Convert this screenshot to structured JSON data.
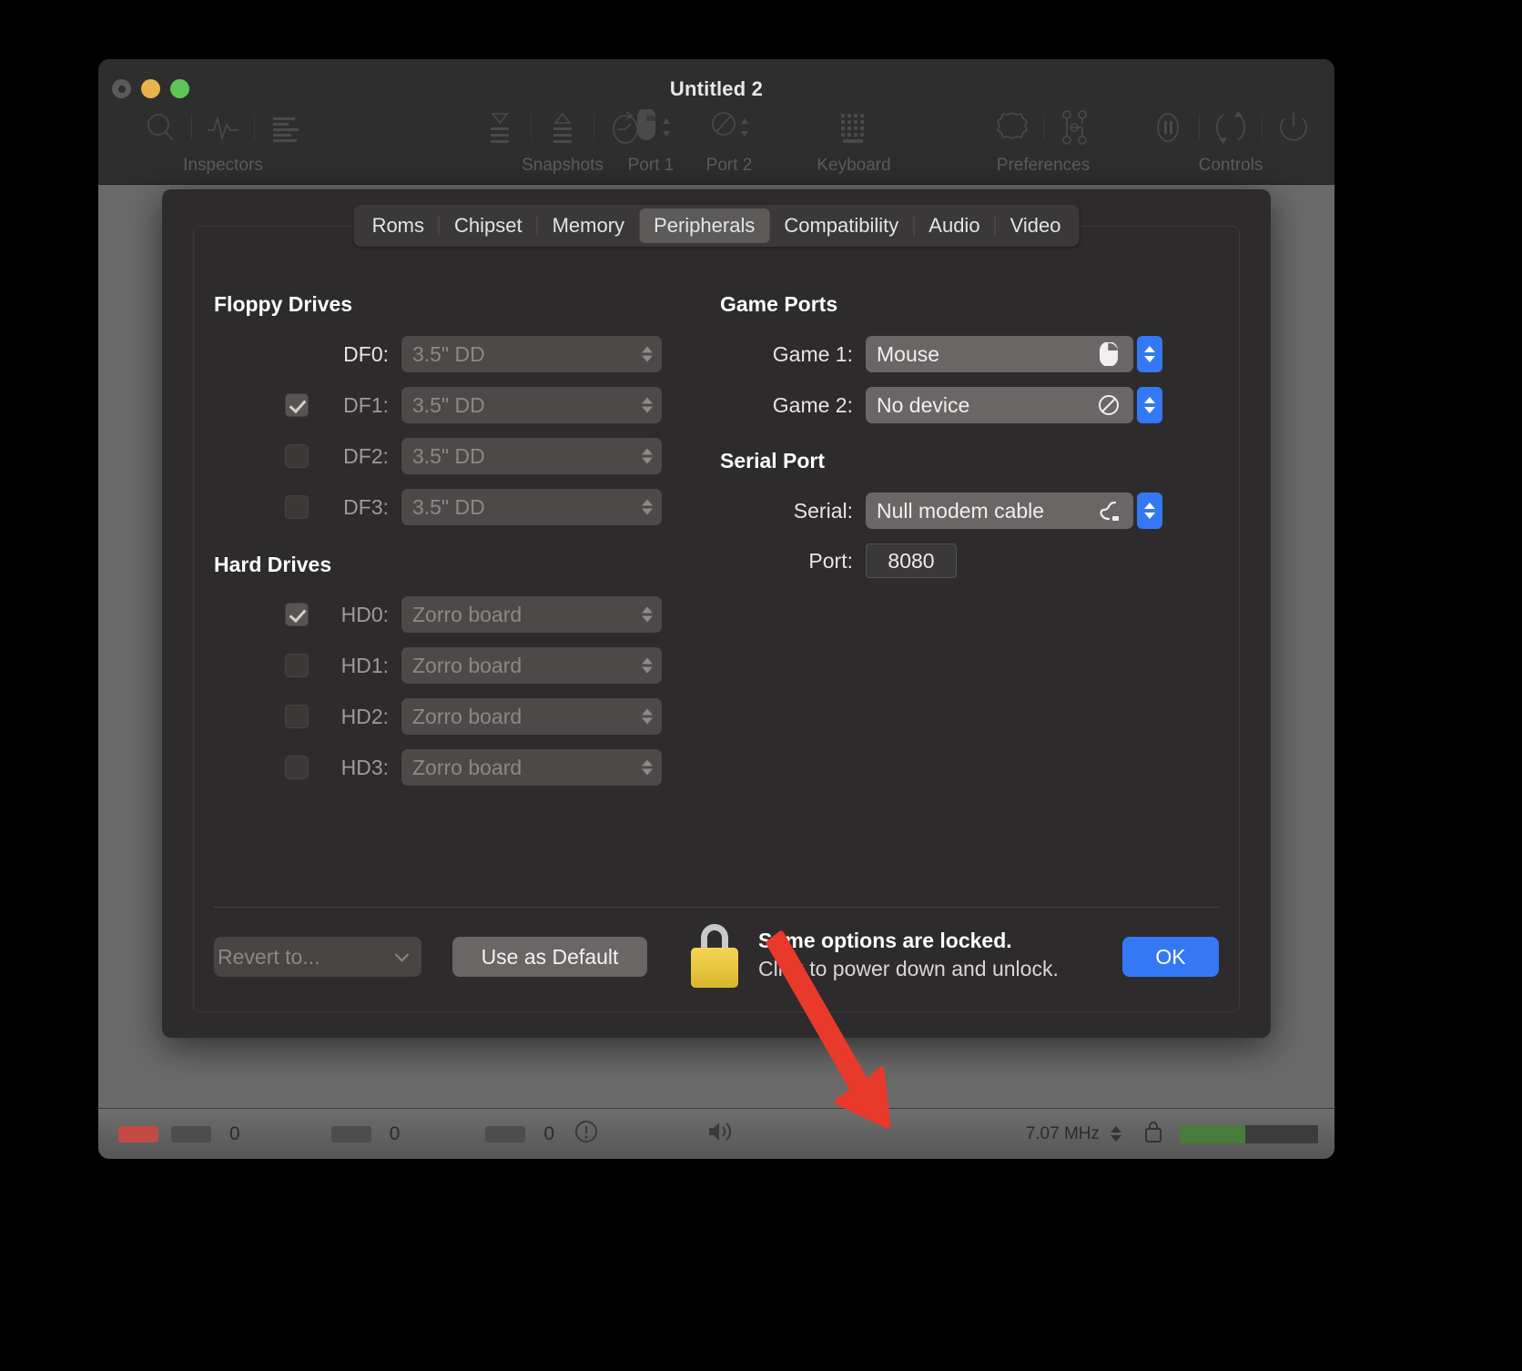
{
  "window": {
    "title": "Untitled 2",
    "traffic_lights": [
      "close",
      "minimize",
      "zoom"
    ]
  },
  "toolbar": {
    "groups": [
      {
        "label": "Inspectors",
        "icons": [
          "magnifier-icon",
          "waveform-icon",
          "list-lines-icon"
        ]
      },
      {
        "label": "Snapshots",
        "icons": [
          "snapshot-take-icon",
          "snapshot-restore-icon",
          "revert-clock-icon"
        ]
      },
      {
        "label": "Port 1",
        "icons": [
          "mouse-icon"
        ]
      },
      {
        "label": "Port 2",
        "icons": [
          "no-device-icon"
        ]
      },
      {
        "label": "Keyboard",
        "icons": [
          "keyboard-icon"
        ]
      },
      {
        "label": "Preferences",
        "icons": [
          "gear-icon",
          "config-nodes-icon"
        ]
      },
      {
        "label": "Controls",
        "icons": [
          "pause-icon",
          "reset-icon",
          "power-icon"
        ]
      }
    ]
  },
  "tabs": [
    {
      "label": "Roms",
      "active": false
    },
    {
      "label": "Chipset",
      "active": false
    },
    {
      "label": "Memory",
      "active": false
    },
    {
      "label": "Peripherals",
      "active": true
    },
    {
      "label": "Compatibility",
      "active": false
    },
    {
      "label": "Audio",
      "active": false
    },
    {
      "label": "Video",
      "active": false
    }
  ],
  "panel": {
    "floppy_drives": {
      "title": "Floppy Drives",
      "rows": [
        {
          "label": "DF0:",
          "has_checkbox": false,
          "checked": true,
          "value": "3.5\" DD",
          "enabled": false
        },
        {
          "label": "DF1:",
          "has_checkbox": true,
          "checked": true,
          "value": "3.5\" DD",
          "enabled": false
        },
        {
          "label": "DF2:",
          "has_checkbox": true,
          "checked": false,
          "value": "3.5\" DD",
          "enabled": false
        },
        {
          "label": "DF3:",
          "has_checkbox": true,
          "checked": false,
          "value": "3.5\" DD",
          "enabled": false
        }
      ]
    },
    "hard_drives": {
      "title": "Hard Drives",
      "rows": [
        {
          "label": "HD0:",
          "has_checkbox": true,
          "checked": true,
          "value": "Zorro board",
          "enabled": false
        },
        {
          "label": "HD1:",
          "has_checkbox": true,
          "checked": false,
          "value": "Zorro board",
          "enabled": false
        },
        {
          "label": "HD2:",
          "has_checkbox": true,
          "checked": false,
          "value": "Zorro board",
          "enabled": false
        },
        {
          "label": "HD3:",
          "has_checkbox": true,
          "checked": false,
          "value": "Zorro board",
          "enabled": false
        }
      ]
    },
    "game_ports": {
      "title": "Game Ports",
      "rows": [
        {
          "label": "Game 1:",
          "value": "Mouse",
          "icon": "mouse-icon",
          "enabled": true
        },
        {
          "label": "Game 2:",
          "value": "No device",
          "icon": "no-device-icon",
          "enabled": true
        }
      ]
    },
    "serial_port": {
      "title": "Serial Port",
      "device_label": "Serial:",
      "device_value": "Null modem cable",
      "device_icon": "serial-cable-icon",
      "port_label": "Port:",
      "port_value": "8080"
    }
  },
  "footer": {
    "revert_label": "Revert to...",
    "use_default_label": "Use as Default",
    "lock_title": "Some options are locked.",
    "lock_subtitle": "Click to power down and unlock.",
    "lock_icon": "padlock-closed-icon",
    "ok_label": "OK"
  },
  "statusbar": {
    "items": [
      {
        "type": "led",
        "name": "df0-led",
        "color": "#c24a44"
      },
      {
        "type": "led",
        "name": "df1-led",
        "color": "#4d4d4d"
      },
      {
        "type": "num",
        "value": "0"
      },
      {
        "type": "led",
        "name": "hd0-led",
        "color": "#4d4d4d"
      },
      {
        "type": "num",
        "value": "0"
      },
      {
        "type": "led",
        "name": "hd1-led",
        "color": "#4d4d4d"
      },
      {
        "type": "num",
        "value": "0"
      }
    ],
    "warn_icon": "warning-icon",
    "audio_icon": "speaker-icon",
    "clock": "7.07 MHz",
    "lock_icon": "small-lock-icon",
    "power_bar_color": "#4a7a3c"
  },
  "colors": {
    "accent_blue": "#3478f6",
    "lock_yellow": "#e8c53e",
    "arrow_red": "#e8392a",
    "window_bg": "#2b2b2b",
    "sheet_bg": "#2d2b2b"
  }
}
